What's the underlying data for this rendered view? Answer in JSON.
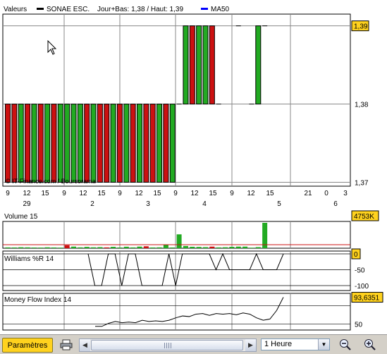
{
  "chart_data": [
    {
      "type": "candlestick",
      "title": "",
      "legend": [
        {
          "label": "Valeurs",
          "swatch": ""
        },
        {
          "label": "SONAE ESC.",
          "swatch": "#000000"
        },
        {
          "label": "Jour+Bas: 1,38 / Haut: 1,39",
          "swatch": ""
        },
        {
          "label": "MA50",
          "swatch": "#0000ff"
        }
      ],
      "ylim": [
        1.3695,
        1.3915
      ],
      "y_ticks": [
        "1,37",
        "1,38"
      ],
      "last_value": "1,39",
      "watermark": "© IT-Finance.com / Boursorama",
      "x_tick_hours": [
        "9",
        "12",
        "15",
        "9",
        "12",
        "15",
        "9",
        "12",
        "15",
        "9",
        "12",
        "15",
        "9",
        "12",
        "15",
        "21",
        "0",
        "3"
      ],
      "x_tick_days": [
        {
          "label": "29",
          "index": 1
        },
        {
          "label": "2",
          "index": 4
        },
        {
          "label": "3",
          "index": 7
        },
        {
          "label": "4",
          "index": 10
        },
        {
          "label": "5",
          "index": 13
        },
        {
          "label": "6",
          "index": 16
        }
      ],
      "candles": [
        {
          "t": 0,
          "open": 1.38,
          "close": 1.37
        },
        {
          "t": 1,
          "open": 1.38,
          "close": 1.37
        },
        {
          "t": 2,
          "open": 1.37,
          "close": 1.38
        },
        {
          "t": 3,
          "open": 1.38,
          "close": 1.37
        },
        {
          "t": 4,
          "open": 1.37,
          "close": 1.38
        },
        {
          "t": 5,
          "open": 1.38,
          "close": 1.37
        },
        {
          "t": 6,
          "open": 1.37,
          "close": 1.38
        },
        {
          "t": 7,
          "open": 1.38,
          "close": 1.37
        },
        {
          "t": 8,
          "open": 1.37,
          "close": 1.38
        },
        {
          "t": 9,
          "open": 1.37,
          "close": 1.38
        },
        {
          "t": 10,
          "open": 1.37,
          "close": 1.38
        },
        {
          "t": 11,
          "open": 1.37,
          "close": 1.38
        },
        {
          "t": 12,
          "open": 1.38,
          "close": 1.37
        },
        {
          "t": 13,
          "open": 1.37,
          "close": 1.38
        },
        {
          "t": 14,
          "open": 1.38,
          "close": 1.37
        },
        {
          "t": 15,
          "open": 1.38,
          "close": 1.37
        },
        {
          "t": 16,
          "open": 1.37,
          "close": 1.38
        },
        {
          "t": 17,
          "open": 1.38,
          "close": 1.37
        },
        {
          "t": 18,
          "open": 1.37,
          "close": 1.38
        },
        {
          "t": 19,
          "open": 1.38,
          "close": 1.37
        },
        {
          "t": 20,
          "open": 1.37,
          "close": 1.38
        },
        {
          "t": 21,
          "open": 1.38,
          "close": 1.37
        },
        {
          "t": 22,
          "open": 1.38,
          "close": 1.37
        },
        {
          "t": 23,
          "open": 1.37,
          "close": 1.38
        },
        {
          "t": 24,
          "open": 1.38,
          "close": 1.37
        },
        {
          "t": 25,
          "open": 1.37,
          "close": 1.38
        },
        {
          "t": 26,
          "open": 1.38,
          "close": 1.38
        },
        {
          "t": 27,
          "open": 1.38,
          "close": 1.39
        },
        {
          "t": 28,
          "open": 1.39,
          "close": 1.38
        },
        {
          "t": 29,
          "open": 1.38,
          "close": 1.39
        },
        {
          "t": 30,
          "open": 1.38,
          "close": 1.39
        },
        {
          "t": 31,
          "open": 1.39,
          "close": 1.38
        },
        {
          "t": 32,
          "open": 1.38,
          "close": 1.38
        },
        {
          "t": 35,
          "open": 1.39,
          "close": 1.39
        },
        {
          "t": 37,
          "open": 1.38,
          "close": 1.38
        },
        {
          "t": 38,
          "open": 1.38,
          "close": 1.39
        },
        {
          "t": 39,
          "open": 1.39,
          "close": 1.39
        }
      ],
      "colors": {
        "up": "#22aa22",
        "down": "#cc1111",
        "flat": "#000000",
        "grid": "#888888",
        "axis_label_bg": "#ffd21e"
      }
    },
    {
      "type": "bar",
      "title": "Volume 15",
      "last_value": "4753K",
      "ylim": [
        0,
        4753
      ],
      "values": [
        150,
        140,
        180,
        160,
        130,
        120,
        170,
        140,
        110,
        560,
        300,
        160,
        250,
        170,
        200,
        150,
        260,
        140,
        280,
        150,
        300,
        360,
        140,
        160,
        600,
        140,
        2600,
        420,
        270,
        240,
        200,
        300,
        150,
        180,
        260,
        300,
        300,
        100,
        200,
        4753
      ]
    },
    {
      "type": "line",
      "title": "Williams %R 14",
      "last_value": "0",
      "y_ticks": [
        "0",
        "-50",
        "-100"
      ],
      "ylim": [
        -100,
        0
      ],
      "values": [
        0,
        -100,
        -100,
        0,
        0,
        -100,
        0,
        0,
        -100,
        -100,
        -100,
        -100,
        0,
        -100,
        0,
        0,
        0,
        0,
        0,
        -50,
        0,
        -50,
        -50,
        -50,
        -50,
        0,
        -50,
        -50,
        -50,
        0
      ]
    },
    {
      "type": "line",
      "title": "Money Flow Index 14",
      "last_value": "93,6351",
      "y_ticks": [
        "50"
      ],
      "ylim": [
        40,
        100
      ],
      "values": [
        46,
        46,
        51,
        54,
        52,
        53,
        52,
        56,
        54,
        55,
        54,
        56,
        60,
        63,
        62,
        66,
        67,
        64,
        67,
        66,
        67,
        65,
        68,
        66,
        60,
        56,
        58,
        72,
        93.6351
      ]
    }
  ],
  "toolbar": {
    "params_label": "Paramètres",
    "timeframe": "1 Heure"
  }
}
